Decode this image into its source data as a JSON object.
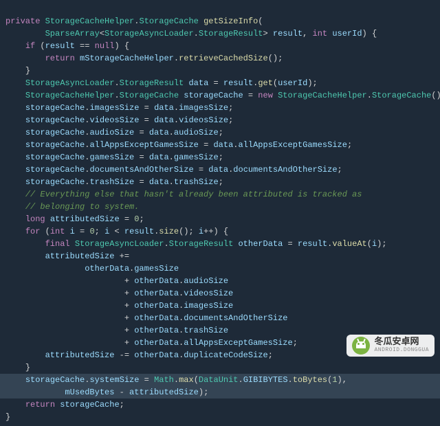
{
  "code": {
    "l1a": "private",
    "l1b": "StorageCacheHelper",
    "l1c": ".",
    "l1d": "StorageCache",
    "l1e": "getSizeInfo",
    "l1f": "(",
    "l2a": "SparseArray",
    "l2b": "<",
    "l2c": "StorageAsyncLoader",
    "l2d": ".",
    "l2e": "StorageResult",
    "l2f": "> ",
    "l2g": "result",
    "l2h": ", ",
    "l2i": "int",
    "l2j": " ",
    "l2k": "userId",
    "l2l": ") {",
    "l3a": "if",
    "l3b": " (",
    "l3c": "result",
    "l3d": " == ",
    "l3e": "null",
    "l3f": ") {",
    "l4a": "return",
    "l4b": " ",
    "l4c": "mStorageCacheHelper",
    "l4d": ".",
    "l4e": "retrieveCachedSize",
    "l4f": "();",
    "l5a": "}",
    "l6a": "StorageAsyncLoader",
    "l6b": ".",
    "l6c": "StorageResult",
    "l6d": " ",
    "l6e": "data",
    "l6f": " = ",
    "l6g": "result",
    "l6h": ".",
    "l6i": "get",
    "l6j": "(",
    "l6k": "userId",
    "l6l": ");",
    "l7a": "StorageCacheHelper",
    "l7b": ".",
    "l7c": "StorageCache",
    "l7d": " ",
    "l7e": "storageCache",
    "l7f": " = ",
    "l7g": "new",
    "l7h": " ",
    "l7i": "StorageCacheHelper",
    "l7j": ".",
    "l7k": "StorageCache",
    "l7l": "();",
    "l8a": "storageCache",
    "l8b": ".",
    "l8c": "imagesSize",
    "l8d": " = ",
    "l8e": "data",
    "l8f": ".",
    "l8g": "imagesSize",
    "l8h": ";",
    "l9a": "storageCache",
    "l9b": ".",
    "l9c": "videosSize",
    "l9d": " = ",
    "l9e": "data",
    "l9f": ".",
    "l9g": "videosSize",
    "l9h": ";",
    "l10a": "storageCache",
    "l10b": ".",
    "l10c": "audioSize",
    "l10d": " = ",
    "l10e": "data",
    "l10f": ".",
    "l10g": "audioSize",
    "l10h": ";",
    "l11a": "storageCache",
    "l11b": ".",
    "l11c": "allAppsExceptGamesSize",
    "l11d": " = ",
    "l11e": "data",
    "l11f": ".",
    "l11g": "allAppsExceptGamesSize",
    "l11h": ";",
    "l12a": "storageCache",
    "l12b": ".",
    "l12c": "gamesSize",
    "l12d": " = ",
    "l12e": "data",
    "l12f": ".",
    "l12g": "gamesSize",
    "l12h": ";",
    "l13a": "storageCache",
    "l13b": ".",
    "l13c": "documentsAndOtherSize",
    "l13d": " = ",
    "l13e": "data",
    "l13f": ".",
    "l13g": "documentsAndOtherSize",
    "l13h": ";",
    "l14a": "storageCache",
    "l14b": ".",
    "l14c": "trashSize",
    "l14d": " = ",
    "l14e": "data",
    "l14f": ".",
    "l14g": "trashSize",
    "l14h": ";",
    "l15": "// Everything else that hasn't already been attributed is tracked as",
    "l16": "// belonging to system.",
    "l17a": "long",
    "l17b": " ",
    "l17c": "attributedSize",
    "l17d": " = ",
    "l17e": "0",
    "l17f": ";",
    "l18a": "for",
    "l18b": " (",
    "l18c": "int",
    "l18d": " ",
    "l18e": "i",
    "l18f": " = ",
    "l18g": "0",
    "l18h": "; ",
    "l18i": "i",
    "l18j": " < ",
    "l18k": "result",
    "l18l": ".",
    "l18m": "size",
    "l18n": "(); ",
    "l18o": "i",
    "l18p": "++) {",
    "l19a": "final",
    "l19b": " ",
    "l19c": "StorageAsyncLoader",
    "l19d": ".",
    "l19e": "StorageResult",
    "l19f": " ",
    "l19g": "otherData",
    "l19h": " = ",
    "l19i": "result",
    "l19j": ".",
    "l19k": "valueAt",
    "l19l": "(",
    "l19m": "i",
    "l19n": ");",
    "l20a": "attributedSize",
    "l20b": " +=",
    "l21a": "otherData",
    "l21b": ".",
    "l21c": "gamesSize",
    "l22a": "+ ",
    "l22b": "otherData",
    "l22c": ".",
    "l22d": "audioSize",
    "l23a": "+ ",
    "l23b": "otherData",
    "l23c": ".",
    "l23d": "videosSize",
    "l24a": "+ ",
    "l24b": "otherData",
    "l24c": ".",
    "l24d": "imagesSize",
    "l25a": "+ ",
    "l25b": "otherData",
    "l25c": ".",
    "l25d": "documentsAndOtherSize",
    "l26a": "+ ",
    "l26b": "otherData",
    "l26c": ".",
    "l26d": "trashSize",
    "l27a": "+ ",
    "l27b": "otherData",
    "l27c": ".",
    "l27d": "allAppsExceptGamesSize",
    "l27e": ";",
    "l28a": "attributedSize",
    "l28b": " -= ",
    "l28c": "otherData",
    "l28d": ".",
    "l28e": "duplicateCodeSize",
    "l28f": ";",
    "l29a": "}",
    "l30a": "storageCache",
    "l30b": ".",
    "l30c": "systemSize",
    "l30d": " = ",
    "l30e": "Math",
    "l30f": ".",
    "l30g": "max",
    "l30h": "(",
    "l30i": "DataUnit",
    "l30j": ".",
    "l30k": "GIBIBYTES",
    "l30l": ".",
    "l30m": "toBytes",
    "l30n": "(",
    "l30o": "1",
    "l30p": "),",
    "l31a": "mUsedBytes",
    "l31b": " - ",
    "l31c": "attributedSize",
    "l31d": ");",
    "l32a": "return",
    "l32b": " ",
    "l32c": "storageCache",
    "l32d": ";",
    "l33a": "}"
  },
  "watermark": {
    "title": "冬瓜安卓网",
    "sub": "ANDROID.DONGGUA"
  }
}
